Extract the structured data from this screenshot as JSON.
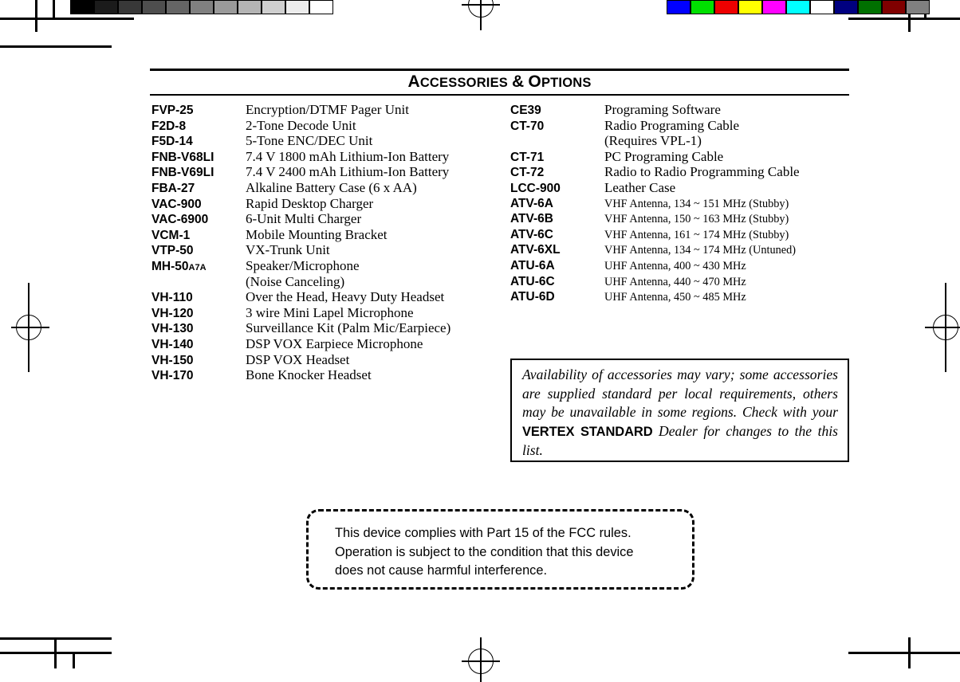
{
  "page": {
    "title_full": "ACCESSORIES & OPTIONS",
    "title_parts": {
      "word1_cap": "A",
      "word1_rest": "CCESSORIES",
      "amp": "&",
      "word2_cap": "O",
      "word2_rest": "PTIONS"
    }
  },
  "left_column": [
    {
      "part": "FVP-25",
      "desc": "Encryption/DTMF Pager Unit"
    },
    {
      "part": "F2D-8",
      "desc": "2-Tone Decode Unit"
    },
    {
      "part": "F5D-14",
      "desc": "5-Tone ENC/DEC Unit"
    },
    {
      "part": "FNB-V68LI",
      "desc": "7.4 V 1800 mAh Lithium-Ion Battery"
    },
    {
      "part": "FNB-V69LI",
      "desc": "7.4 V 2400 mAh Lithium-Ion Battery"
    },
    {
      "part": "FBA-27",
      "desc": "Alkaline Battery Case (6 x AA)"
    },
    {
      "part": "VAC-900",
      "desc": "Rapid Desktop Charger"
    },
    {
      "part": "VAC-6900",
      "desc": "6-Unit Multi Charger"
    },
    {
      "part": "VCM-1",
      "desc": "Mobile Mounting Bracket"
    },
    {
      "part": "VTP-50",
      "desc": "VX-Trunk Unit"
    },
    {
      "part": "MH-50",
      "part_suffix": "A7A",
      "desc": "Speaker/Microphone"
    },
    {
      "part": "",
      "desc": "(Noise Canceling)"
    },
    {
      "part": "VH-110",
      "desc": "Over the Head, Heavy Duty Headset"
    },
    {
      "part": "VH-120",
      "desc": "3 wire Mini Lapel Microphone"
    },
    {
      "part": "VH-130",
      "desc": "Surveillance Kit (Palm Mic/Earpiece)"
    },
    {
      "part": "VH-140",
      "desc": "DSP VOX Earpiece Microphone"
    },
    {
      "part": "VH-150",
      "desc": "DSP VOX Headset"
    },
    {
      "part": "VH-170",
      "desc": "Bone Knocker Headset"
    }
  ],
  "right_column": [
    {
      "part": "CE39",
      "desc": "Programing Software"
    },
    {
      "part": "CT-70",
      "desc": "Radio Programing Cable"
    },
    {
      "part": "",
      "desc": "(Requires VPL-1)"
    },
    {
      "part": "CT-71",
      "desc": "PC Programing Cable"
    },
    {
      "part": "CT-72",
      "desc": "Radio to Radio Programming Cable"
    },
    {
      "part": "LCC-900",
      "desc": "Leather Case"
    },
    {
      "part": "ATV-6A",
      "desc": "VHF Antenna, 134 ~ 151 MHz (Stubby)",
      "small": true
    },
    {
      "part": "ATV-6B",
      "desc": "VHF Antenna, 150 ~ 163 MHz (Stubby)",
      "small": true
    },
    {
      "part": "ATV-6C",
      "desc": "VHF Antenna, 161 ~ 174 MHz (Stubby)",
      "small": true
    },
    {
      "part": "ATV-6XL",
      "desc": "VHF Antenna, 134 ~ 174 MHz (Untuned)",
      "small": true
    },
    {
      "part": "ATU-6A",
      "desc": "UHF Antenna, 400 ~ 430 MHz",
      "small": true
    },
    {
      "part": "ATU-6C",
      "desc": "UHF Antenna, 440 ~ 470 MHz",
      "small": true
    },
    {
      "part": "ATU-6D",
      "desc": "UHF Antenna, 450 ~ 485 MHz",
      "small": true
    }
  ],
  "availability_note": {
    "text_before_brand": "Availability of accessories may vary; some accessories are supplied standard per local requirements, others may be unavailable in some regions. Check with your ",
    "brand": "VERTEX STANDARD",
    "text_after_brand": " Dealer for changes to the this list."
  },
  "fcc_notice": {
    "text": "This device complies with Part 15 of the FCC rules.\nOperation is subject to the condition that this device\ndoes not cause harmful interference."
  },
  "calibration": {
    "grayscale_steps": [
      "#000000",
      "#1b1b1b",
      "#383838",
      "#4e4e4e",
      "#656565",
      "#808080",
      "#9a9a9a",
      "#b4b4b4",
      "#cfcfcf",
      "#ececec",
      "#ffffff"
    ],
    "color_steps": [
      "#0000ff",
      "#00e000",
      "#ee0000",
      "#ffff00",
      "#ff00ff",
      "#00ffff",
      "#ffffff",
      "#000080",
      "#007000",
      "#800000",
      "#808080"
    ]
  }
}
